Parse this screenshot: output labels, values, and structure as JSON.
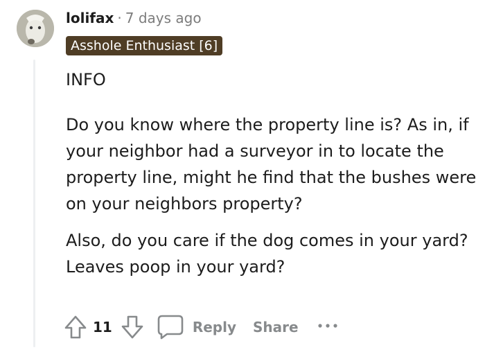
{
  "comment": {
    "username": "lolifax",
    "separator": "·",
    "timestamp": "7 days ago",
    "flair": "Asshole Enthusiast [6]",
    "paragraphs": [
      "INFO",
      "Do you know where the property line is? As in, if your neighbor had a surveyor in to locate the property line, might he find that the bushes were on your neighbors property?",
      "Also, do you care if the dog comes in your yard? Leaves poop in your yard?"
    ]
  },
  "actions": {
    "vote_count": "11",
    "reply_label": "Reply",
    "share_label": "Share"
  },
  "icons": {
    "upvote": "upvote-arrow-icon",
    "downvote": "downvote-arrow-icon",
    "comment": "comment-bubble-icon",
    "more": "more-options-icon"
  },
  "colors": {
    "flair_background": "#4f3d25",
    "muted_text": "#878a8c",
    "thread_line": "#edeff1"
  }
}
